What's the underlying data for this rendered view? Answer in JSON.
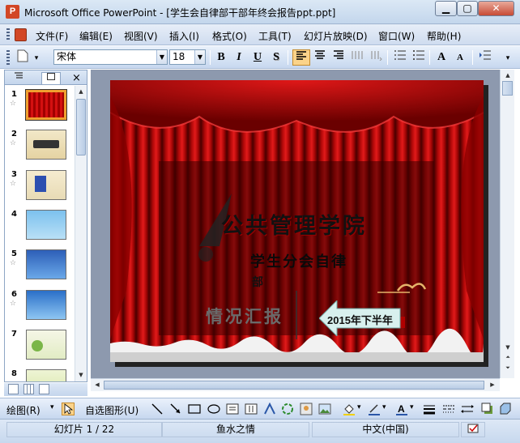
{
  "window": {
    "title": "Microsoft Office PowerPoint - [学生会自律部干部年终会报告ppt.ppt]",
    "app_icon_letter": "P",
    "min_label": "▁",
    "max_label": "▢",
    "close_label": "✕"
  },
  "menu": {
    "items": [
      "文件(F)",
      "编辑(E)",
      "视图(V)",
      "插入(I)",
      "格式(O)",
      "工具(T)",
      "幻灯片放映(D)",
      "窗口(W)",
      "帮助(H)"
    ]
  },
  "toolbar": {
    "font_name": "宋体",
    "font_size": "18",
    "bold": "B",
    "italic": "I",
    "underline": "U",
    "shadow": "S",
    "increase_font": "A",
    "decrease_font": "A"
  },
  "left_panel": {
    "tab_outline_icon": "outline-icon",
    "tab_slides_icon": "slides-icon",
    "close_label": "×",
    "slide_numbers": [
      "1",
      "2",
      "3",
      "4",
      "5",
      "6",
      "7",
      "8"
    ],
    "star": "☆"
  },
  "slide": {
    "title": "公共管理学院",
    "subtitle": "学生分会自律",
    "subtitle_part2": "部",
    "subtitle_part3": "情况汇报",
    "arrow_label": "2015年下半年",
    "colors": {
      "curtain_dark": "#5a0000",
      "curtain_light": "#d01010"
    }
  },
  "drawing_toolbar": {
    "draw_label": "绘图(R)",
    "autoshape_label": "自选图形(U)"
  },
  "status": {
    "slide_info": "幻灯片 1 / 22",
    "design": "鱼水之情",
    "language": "中文(中国)"
  }
}
